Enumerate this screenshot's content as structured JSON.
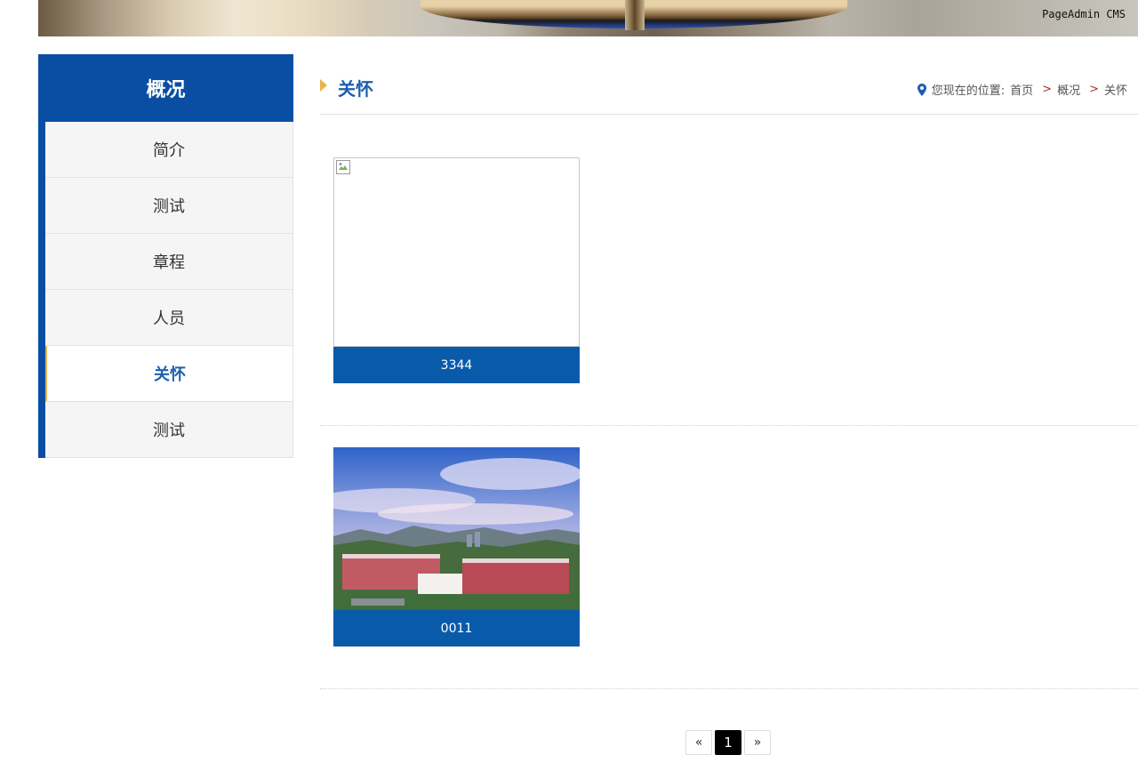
{
  "banner": {
    "brand": "PageAdmin CMS"
  },
  "sidebar": {
    "title": "概况",
    "items": [
      {
        "label": "简介"
      },
      {
        "label": "测试"
      },
      {
        "label": "章程"
      },
      {
        "label": "人员"
      },
      {
        "label": "关怀",
        "active": true
      },
      {
        "label": "测试"
      }
    ]
  },
  "main": {
    "title": "关怀",
    "breadcrumb": {
      "prefix": "您现在的位置:",
      "home": "首页",
      "level1": "概况",
      "level2": "关怀",
      "separator": ">"
    },
    "cards": [
      {
        "label": "3344",
        "image": "broken"
      },
      {
        "label": "0011",
        "image": "campus-photo"
      }
    ]
  },
  "pagination": {
    "prev": "«",
    "current": "1",
    "next": "»"
  },
  "colors": {
    "primary": "#0a4ea3",
    "accent": "#e8b54a",
    "title": "#1d5fae"
  }
}
